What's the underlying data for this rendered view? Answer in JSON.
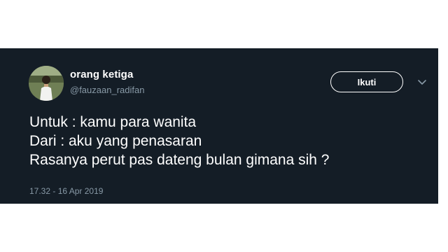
{
  "tweet": {
    "author": {
      "display_name": "orang ketiga",
      "handle": "@fauzaan_radifan",
      "avatar_icon": "person-photo-avatar"
    },
    "follow_label": "Ikuti",
    "more_icon": "chevron-down-icon",
    "lines": [
      "Untuk : kamu para wanita",
      "Dari : aku yang penasaran",
      "Rasanya perut pas dateng bulan gimana sih ?"
    ],
    "timestamp": "17.32 - 16 Apr 2019"
  },
  "colors": {
    "card_background": "#141d26",
    "primary_text": "#ffffff",
    "secondary_text": "#8899a6"
  }
}
